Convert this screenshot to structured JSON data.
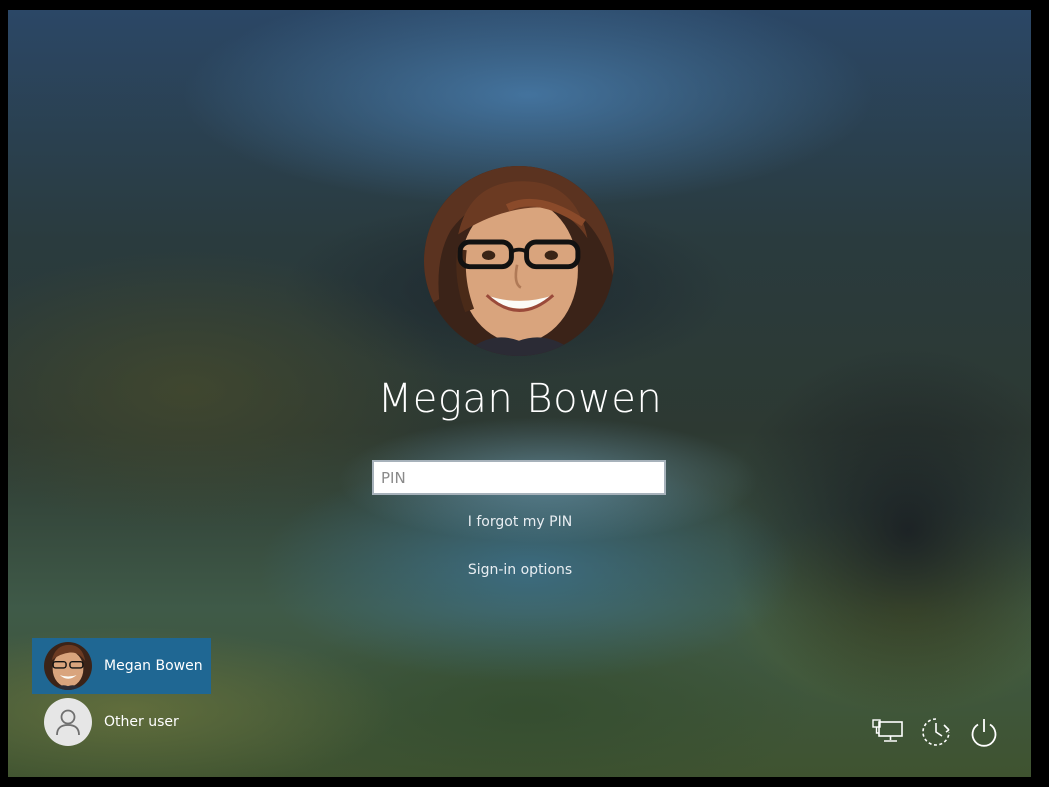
{
  "user": {
    "name": "Megan Bowen"
  },
  "pin_input": {
    "placeholder": "PIN",
    "value": ""
  },
  "links": {
    "forgot_pin": "I forgot my PIN",
    "sign_in_options": "Sign-in options"
  },
  "user_list": {
    "items": [
      {
        "label": "Megan Bowen",
        "selected": true,
        "icon": "profile-photo"
      },
      {
        "label": "Other user",
        "selected": false,
        "icon": "person-icon"
      }
    ]
  },
  "system_icons": {
    "network": "network-icon",
    "ease_of_access": "ease-of-access-icon",
    "power": "power-icon"
  },
  "colors": {
    "selected_user_bg": "#1f6793",
    "text": "#ffffff",
    "input_border": "#a7b2bb"
  }
}
